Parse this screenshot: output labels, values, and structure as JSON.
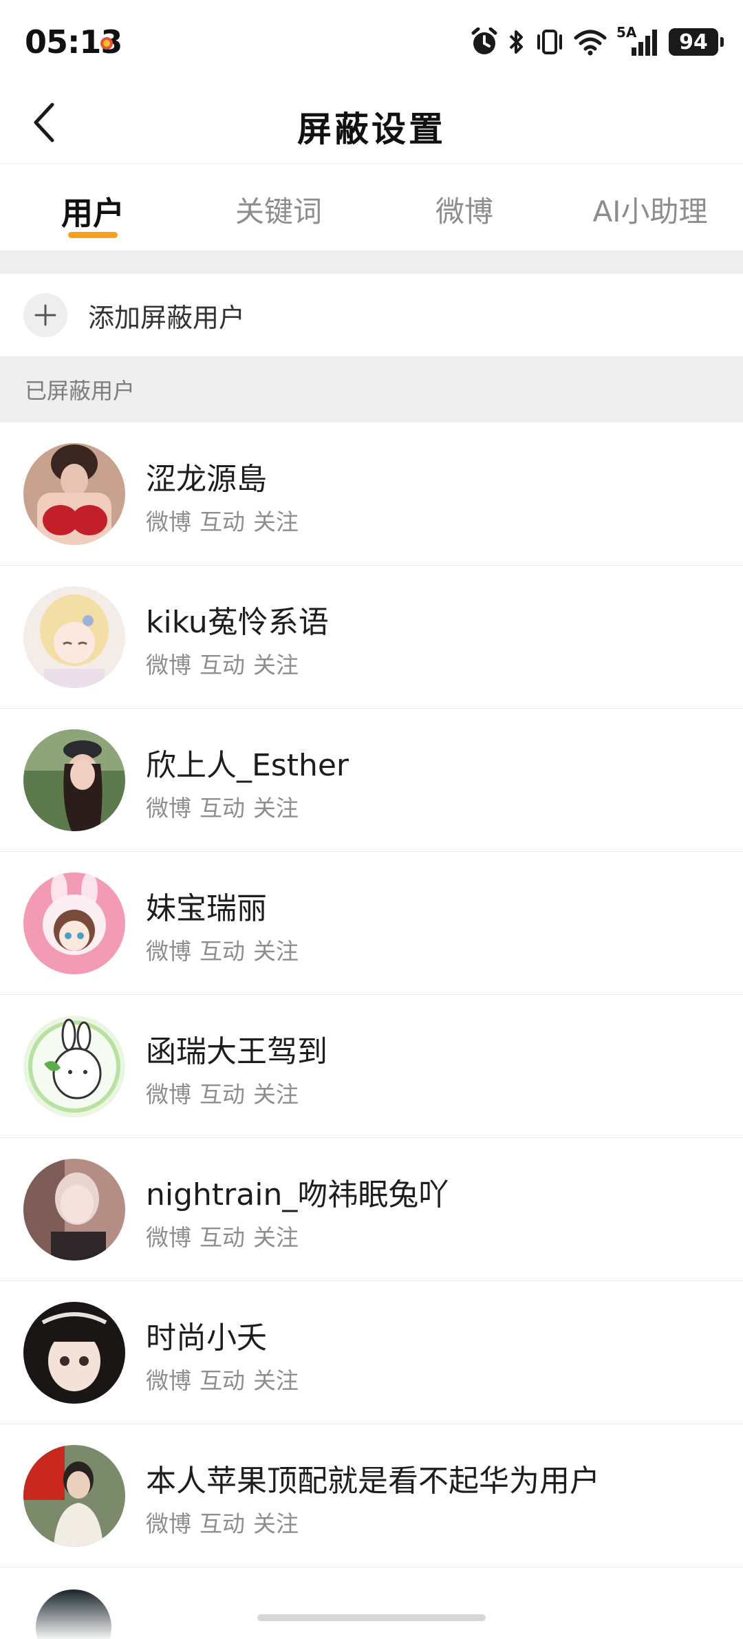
{
  "status_bar": {
    "time": "05:13",
    "network": "5A",
    "battery": "94"
  },
  "header": {
    "title": "屏蔽设置",
    "back_icon": "chevron-left-icon"
  },
  "tabs": [
    {
      "label": "用户",
      "active": true
    },
    {
      "label": "关键词",
      "active": false
    },
    {
      "label": "微博",
      "active": false
    },
    {
      "label": "AI小助理",
      "active": false
    }
  ],
  "add_row": {
    "icon": "plus-icon",
    "label": "添加屏蔽用户"
  },
  "section": {
    "title": "已屏蔽用户"
  },
  "users": [
    {
      "name": "涩龙源島",
      "tags": [
        "微博",
        "互动",
        "关注"
      ]
    },
    {
      "name": "kiku菟怜系语",
      "tags": [
        "微博",
        "互动",
        "关注"
      ]
    },
    {
      "name": "欣上人_Esther",
      "tags": [
        "微博",
        "互动",
        "关注"
      ]
    },
    {
      "name": "妹宝瑞丽",
      "tags": [
        "微博",
        "互动",
        "关注"
      ]
    },
    {
      "name": "函瑞大王驾到",
      "tags": [
        "微博",
        "互动",
        "关注"
      ]
    },
    {
      "name": "nightrain_吻祎眠兔吖",
      "tags": [
        "微博",
        "互动",
        "关注"
      ]
    },
    {
      "name": "时尚小夭",
      "tags": [
        "微博",
        "互动",
        "关注"
      ]
    },
    {
      "name": "本人苹果顶配就是看不起华为用户",
      "tags": [
        "微博",
        "互动",
        "关注"
      ]
    }
  ],
  "colors": {
    "accent": "#f7a11c",
    "section_bg": "#eeeeee",
    "secondary_text": "#8e8e8e"
  }
}
